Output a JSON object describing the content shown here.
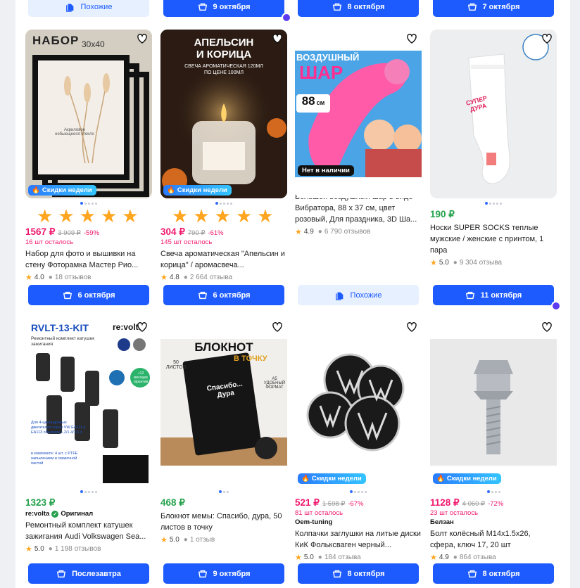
{
  "top_buttons": [
    "Похожие",
    "9 октября",
    "8 октября",
    "7 октября"
  ],
  "products": [
    {
      "image": "photo-frames",
      "sale_badge": "Скидки недели",
      "stars_widget": true,
      "price": "1567 ₽",
      "old_price": "3 909 ₽",
      "discount": "-59%",
      "left": "16 шт осталось",
      "title": "Набор для фото и вышивки на стену Фоторамка Мастер Рио...",
      "rating": "4.0",
      "reviews": "18 отзывов",
      "button": "6 октября",
      "img_text": {
        "line1": "НАБОР",
        "line2": "30x40",
        "small": "Акриловое небьющееся стекло"
      }
    },
    {
      "image": "candle",
      "sale_badge": "Скидки недели",
      "stars_widget": true,
      "price": "304 ₽",
      "old_price": "790 ₽",
      "discount": "-61%",
      "left": "145 шт осталось",
      "title": "Свеча ароматическая \"Апельсин и корица\" / аромасвеча...",
      "rating": "4.8",
      "reviews": "2 664 отзыва",
      "button": "6 октября",
      "img_text": {
        "line1": "АПЕЛЬСИН",
        "line2": "И КОРИЦА",
        "small": "СВЕЧА АРОМАТИЧЕСКАЯ 120МЛ ПО ЦЕНЕ 100МЛ"
      }
    },
    {
      "image": "balloon",
      "na_badge": "Нет в наличии",
      "title": "Большой воздушный шар в виде Вибратора, 88 x 37 см, цвет розовый, Для праздника, 3D Ша...",
      "rating": "4.9",
      "reviews": "6 790 отзывов",
      "button": "Похожие",
      "img_text": {
        "line1": "ВОЗДУШНЫЙ",
        "line2": "ШАР",
        "small": "88",
        "unit": "см"
      }
    },
    {
      "image": "socks",
      "price": "190 ₽",
      "title": "Носки SUPER SOCKS теплые мужские / женские с принтом, 1 пара",
      "rating": "5.0",
      "reviews": "9 304 отзыва",
      "button": "11 октября",
      "img_text": {
        "line1": "СУПЕР",
        "line2": "ДУРА"
      }
    },
    {
      "image": "ignition-kit",
      "price": "1323 ₽",
      "brand": "re:volta",
      "brand_tag": "Оригинал",
      "title": "Ремонтный комплект катушек зажигания Audi Volkswagen Sea...",
      "rating": "5.0",
      "reviews": "1 198 отзывов",
      "button": "Послезавтра",
      "img_text": {
        "line1": "RVLT-13-KIT",
        "line2": "re:volta",
        "small": "Ремонтный комплект катушек зажигания",
        "warranty": "+12 месяцев гарантии",
        "note": "Для 4-цилиндровых двигателей серии VW EA111 и EA113 объемом 1.2/1.4/1.6 л",
        "kit": "в комплекте: 4 шт. с PTFE напылением и смазочной пастой"
      }
    },
    {
      "image": "notebook",
      "price": "468 ₽",
      "title": "Блокнот мемы: Спасибо, дура, 50 листов в точку",
      "rating": "5.0",
      "reviews": "1 отзыв",
      "button": "9 октября",
      "img_text": {
        "line1": "БЛОКНОТ",
        "line2": "В ТОЧКУ",
        "small": "Спасибо... Дура",
        "pages": "50 ЛИСТОВ",
        "format": "A5 УДОБНЫЙ ФОРМАТ"
      }
    },
    {
      "image": "vw-caps",
      "sale_badge": "Скидки недели",
      "price": "521 ₽",
      "old_price": "1 598 ₽",
      "discount": "-67%",
      "left": "81 шт осталось",
      "brand": "Oem-tuning",
      "title": "Колпачки заглушки на литые диски КиК Фольксваген черный...",
      "rating": "5.0",
      "reviews": "184 отзыва",
      "button": "8 октября"
    },
    {
      "image": "wheel-bolt",
      "sale_badge": "Скидки недели",
      "price": "1128 ₽",
      "old_price": "4 060 ₽",
      "discount": "-72%",
      "left": "23 шт осталось",
      "brand": "Белзан",
      "title": "Болт колёсный М14х1.5х26, сфера, ключ 17, 20 шт",
      "rating": "4.9",
      "reviews": "864 отзыва",
      "button": "8 октября"
    }
  ],
  "colors": {
    "accent": "#1d5bff",
    "sale": "#f0186d",
    "star": "#ffa51f",
    "green": "#23a14a"
  }
}
